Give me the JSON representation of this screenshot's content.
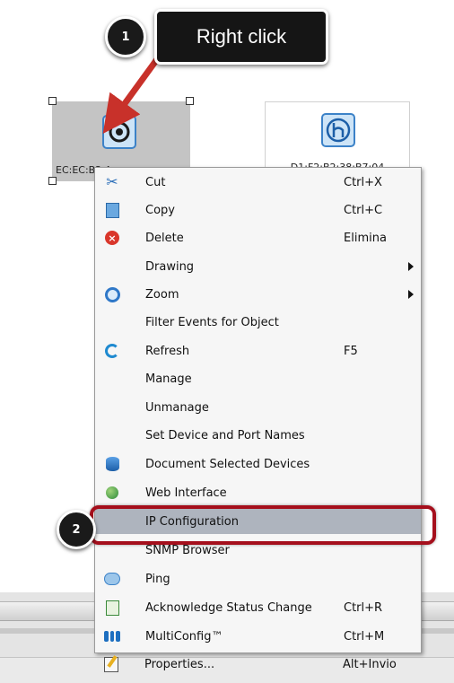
{
  "callouts": {
    "step1": "1",
    "step1_text": "Right click",
    "step2": "2"
  },
  "devices": {
    "selected_label": "EC:EC:B2:A1:12",
    "other_label": "D1:F2:B2:38:B7:04"
  },
  "context_menu": {
    "items": [
      {
        "label": "Cut",
        "shortcut": "Ctrl+X",
        "icon": "scissors-icon"
      },
      {
        "label": "Copy",
        "shortcut": "Ctrl+C",
        "icon": "copy-icon"
      },
      {
        "label": "Delete",
        "shortcut": "Elimina",
        "icon": "delete-icon"
      },
      {
        "label": "Drawing",
        "shortcut": "",
        "icon": "",
        "submenu": true
      },
      {
        "label": "Zoom",
        "shortcut": "",
        "icon": "zoom-icon",
        "submenu": true
      },
      {
        "label": "Filter Events for Object",
        "shortcut": "",
        "icon": ""
      },
      {
        "label": "Refresh",
        "shortcut": "F5",
        "icon": "refresh-icon"
      },
      {
        "label": "Manage",
        "shortcut": "",
        "icon": ""
      },
      {
        "label": "Unmanage",
        "shortcut": "",
        "icon": ""
      },
      {
        "label": "Set Device and Port Names",
        "shortcut": "",
        "icon": ""
      },
      {
        "label": "Document Selected Devices",
        "shortcut": "",
        "icon": "database-icon"
      },
      {
        "label": "Web Interface",
        "shortcut": "",
        "icon": "globe-icon"
      },
      {
        "label": "IP Configuration",
        "shortcut": "",
        "icon": "",
        "highlighted": true
      },
      {
        "label": "SNMP Browser",
        "shortcut": "",
        "icon": ""
      },
      {
        "label": "Ping",
        "shortcut": "",
        "icon": "ping-icon"
      },
      {
        "label": "Acknowledge Status Change",
        "shortcut": "Ctrl+R",
        "icon": "acknowledge-icon"
      },
      {
        "label": "MultiConfig™",
        "shortcut": "Ctrl+M",
        "icon": "multiconfig-icon"
      },
      {
        "label": "Properties...",
        "shortcut": "Alt+Invio",
        "icon": "properties-icon"
      }
    ]
  },
  "colors": {
    "highlight_ring": "#a50f1c",
    "callout_bg": "#1a1a1a",
    "arrow": "#c8312a",
    "menu_highlight": "#aeb4be"
  }
}
